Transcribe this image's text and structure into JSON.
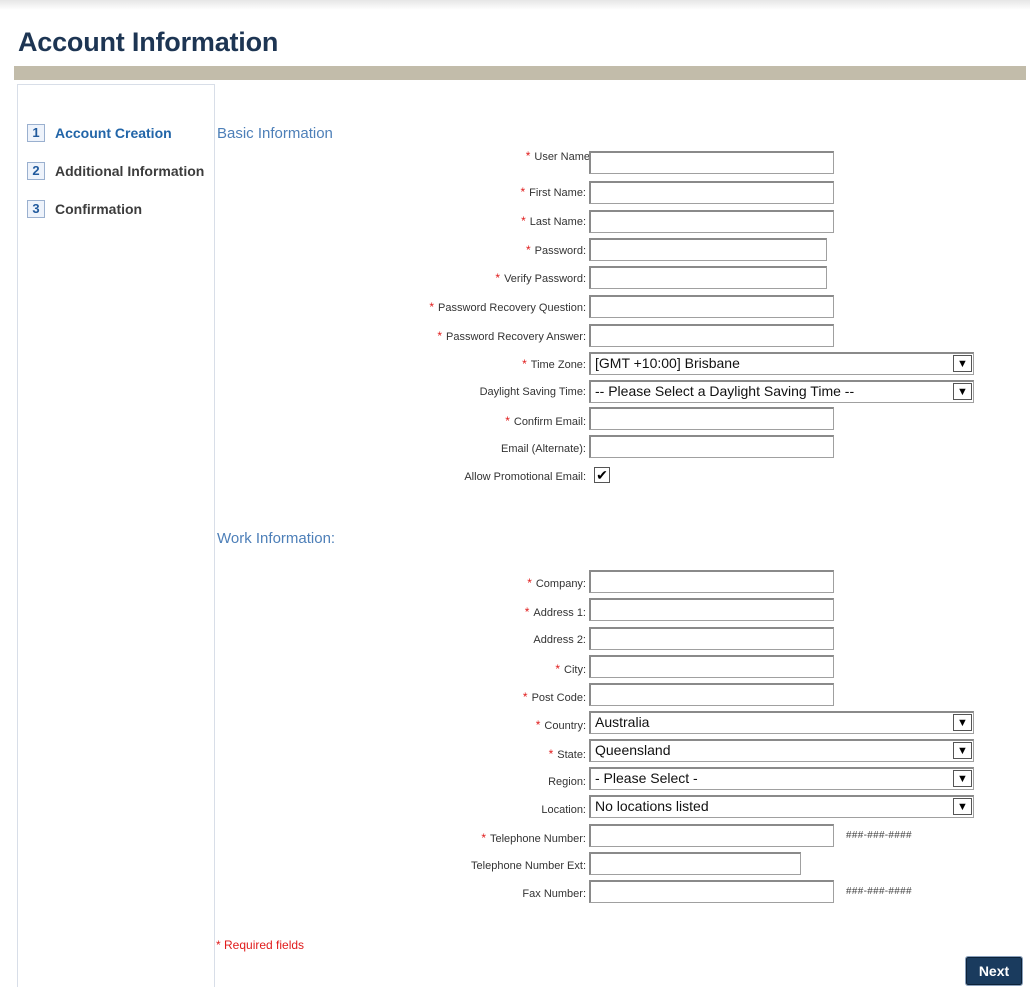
{
  "page": {
    "title": "Account Information"
  },
  "steps": [
    {
      "num": "1",
      "label": "Account Creation"
    },
    {
      "num": "2",
      "label": "Additional Information"
    },
    {
      "num": "3",
      "label": "Confirmation"
    }
  ],
  "sections": {
    "basic": "Basic Information",
    "work": "Work Information:"
  },
  "required_marker": "*",
  "basic_fields": {
    "user_name": {
      "label": "User Name",
      "value": ""
    },
    "first_name": {
      "label": "First Name:",
      "value": ""
    },
    "last_name": {
      "label": "Last Name:",
      "value": ""
    },
    "password": {
      "label": "Password:",
      "value": ""
    },
    "verify_password": {
      "label": "Verify Password:",
      "value": ""
    },
    "recovery_question": {
      "label": "Password Recovery Question:",
      "value": ""
    },
    "recovery_answer": {
      "label": "Password Recovery Answer:",
      "value": ""
    },
    "time_zone": {
      "label": "Time Zone:",
      "value": "[GMT +10:00] Brisbane"
    },
    "daylight_saving": {
      "label": "Daylight Saving Time:",
      "value": "-- Please Select a Daylight Saving Time --"
    },
    "confirm_email": {
      "label": "Confirm Email:",
      "value": ""
    },
    "email_alternate": {
      "label": "Email (Alternate):",
      "value": ""
    },
    "allow_promo": {
      "label": "Allow Promotional Email:",
      "checked": true,
      "check_glyph": "✔"
    }
  },
  "work_fields": {
    "company": {
      "label": "Company:",
      "value": ""
    },
    "address1": {
      "label": "Address 1:",
      "value": ""
    },
    "address2": {
      "label": "Address 2:",
      "value": ""
    },
    "city": {
      "label": "City:",
      "value": ""
    },
    "post_code": {
      "label": "Post Code:",
      "value": ""
    },
    "country": {
      "label": "Country:",
      "value": "Australia"
    },
    "state": {
      "label": "State:",
      "value": "Queensland"
    },
    "region": {
      "label": "Region:",
      "value": "- Please Select -"
    },
    "location": {
      "label": "Location:",
      "value": "No locations listed"
    },
    "telephone": {
      "label": "Telephone Number:",
      "value": "",
      "hint": "###-###-####"
    },
    "telephone_ext": {
      "label": "Telephone Number Ext:",
      "value": ""
    },
    "fax": {
      "label": "Fax Number:",
      "value": "",
      "hint": "###-###-####"
    }
  },
  "footer": {
    "required_note": "* Required fields",
    "next_label": "Next"
  },
  "icons": {
    "dropdown": "chevron-down-icon",
    "arrow_glyph": "▼"
  },
  "colors": {
    "title": "#1d3553",
    "section": "#4d7fb8",
    "required": "#e01b1b",
    "button": "#1a3b5e"
  }
}
